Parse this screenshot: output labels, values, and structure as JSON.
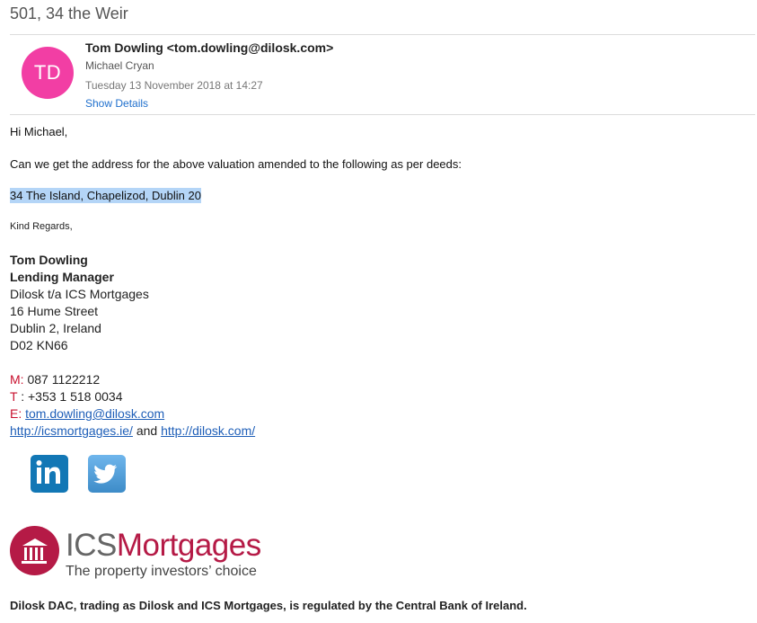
{
  "subject": "501, 34 the Weir",
  "header": {
    "avatar_initials": "TD",
    "avatar_color": "#f23ea4",
    "from": "Tom Dowling <tom.dowling@dilosk.com>",
    "to": "Michael Cryan",
    "date": "Tuesday 13 November 2018 at 14:27",
    "show_details": "Show Details"
  },
  "message": {
    "greeting": "Hi Michael,",
    "request": "Can we get the address for the above valuation amended to the following as per deeds:",
    "address": "34 The Island, Chapelizod, Dublin 20",
    "closing": "Kind Regards,"
  },
  "signature": {
    "name": "Tom Dowling",
    "title": "Lending Manager",
    "company": "Dilosk t/a ICS Mortgages",
    "street": "16 Hume Street",
    "city": "Dublin 2, Ireland",
    "postcode": "D02 KN66",
    "mobile_label": "M:",
    "mobile": "087 1122212",
    "tel_label": "T",
    "tel": ": +353 1 518 0034",
    "email_label": "E:",
    "email": "tom.dowling@dilosk.com",
    "link1": "http://icsmortgages.ie/",
    "and": "and",
    "link2": "http://dilosk.com/"
  },
  "social": {
    "linkedin_icon": "linkedin-icon",
    "twitter_icon": "twitter-icon"
  },
  "logo": {
    "ics": "ICS",
    "mortgages": "Mortgages",
    "tagline": "The property investors’ choice",
    "brand_color": "#b51a46"
  },
  "footer": "Dilosk DAC, trading as Dilosk and ICS Mortgages, is regulated by the Central Bank of Ireland."
}
